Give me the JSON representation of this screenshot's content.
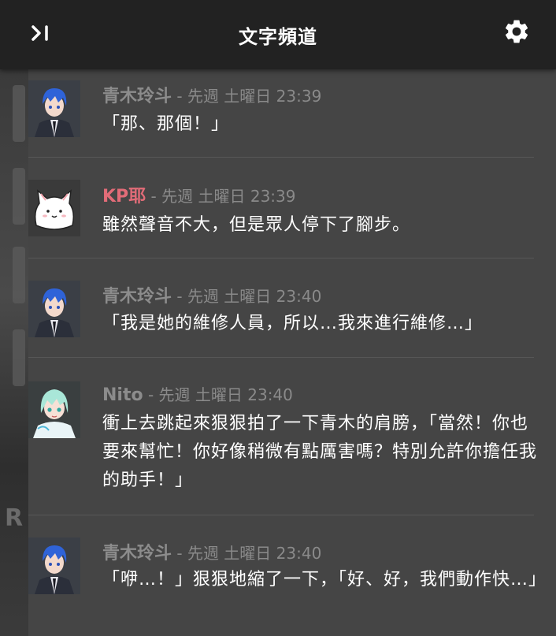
{
  "header": {
    "title": "文字頻道"
  },
  "colors": {
    "header_bg": "#222222",
    "panel_bg": "#454545",
    "author_default": "#8c8c8c",
    "author_kp": "#e26c78",
    "timestamp": "#8a8a8a",
    "message_text": "#ffffff"
  },
  "messages": [
    {
      "author": "青木玲斗",
      "sep": " - ",
      "time": "先週 土曜日 23:39",
      "text": "「那、那個！」",
      "avatar": "blue-hair-boy-avatar"
    },
    {
      "author": "KP耶",
      "sep": " - ",
      "time": "先週 土曜日 23:39",
      "text": "雖然聲音不大，但是眾人停下了腳步。",
      "avatar": "white-cat-avatar"
    },
    {
      "author": "青木玲斗",
      "sep": " - ",
      "time": "先週 土曜日 23:40",
      "text": "「我是她的維修人員，所以…我來進行維修…」",
      "avatar": "blue-hair-boy-avatar"
    },
    {
      "author": "Nito",
      "sep": " - ",
      "time": "先週 土曜日 23:40",
      "text": "衝上去跳起來狠狠拍了一下青木的肩膀，「當然！你也要來幫忙！你好像稍微有點厲害嗎？特別允許你擔任我的助手！」",
      "avatar": "mint-hair-girl-avatar"
    },
    {
      "author": "青木玲斗",
      "sep": " - ",
      "time": "先週 土曜日 23:40",
      "text": "「咿…！」狠狠地縮了一下，「好、好，我們動作快…」",
      "avatar": "blue-hair-boy-avatar"
    }
  ],
  "background": {
    "letter": "R"
  }
}
